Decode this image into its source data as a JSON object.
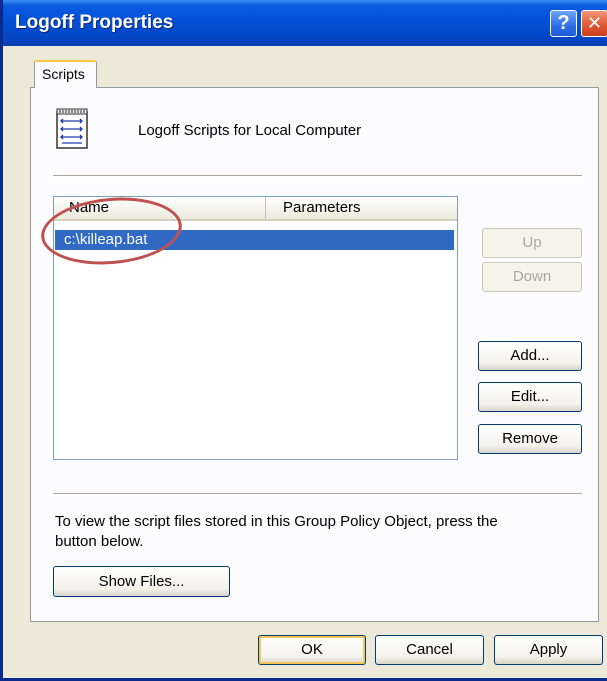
{
  "window": {
    "title": "Logoff Properties",
    "help_glyph": "?",
    "close_glyph": "✕"
  },
  "tab": {
    "label": "Scripts"
  },
  "header": {
    "description": "Logoff Scripts for Local Computer"
  },
  "list": {
    "columns": [
      "Name",
      "Parameters"
    ],
    "rows": [
      {
        "name": "c:\\killeap.bat",
        "parameters": "",
        "selected": true
      }
    ]
  },
  "side_buttons": {
    "up": "Up",
    "down": "Down",
    "add": "Add...",
    "edit": "Edit...",
    "remove": "Remove"
  },
  "info": {
    "text": "To view the script files stored in this Group Policy Object, press the button below."
  },
  "show_files_button": "Show Files...",
  "dialog_buttons": {
    "ok": "OK",
    "cancel": "Cancel",
    "apply": "Apply"
  },
  "colors": {
    "titlebar": "#0450d6",
    "selection": "#316ac5",
    "annotation": "#c0504d",
    "dialog_bg": "#ece9d8"
  }
}
